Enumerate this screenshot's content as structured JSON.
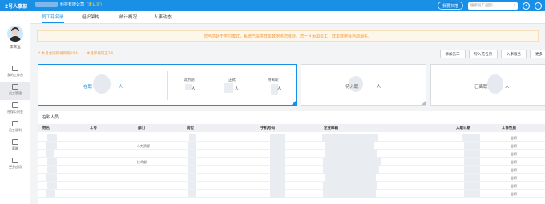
{
  "topbar": {
    "logo": "2号人事部",
    "company_suffix": "科技有限公司",
    "verified": "(未认证)",
    "help": "我要扫描",
    "search_placeholder": "搜索员工/团队",
    "search_icon_char": "⌕"
  },
  "sidebar": {
    "user_name": "李荣运",
    "items": [
      {
        "label": "我的工作台"
      },
      {
        "label": "员工管理"
      },
      {
        "label": "社保公积金"
      },
      {
        "label": "员工福利"
      },
      {
        "label": "薪酬"
      },
      {
        "label": "更多应用"
      }
    ]
  },
  "tabs": [
    "员工花名册",
    "组织架构",
    "统计概况",
    "人事动态"
  ],
  "notice": "您当前处于学习模式，系统已提供样本数据供您体验。您一旦添加员工，样本数据会自动消失。",
  "alerts": [
    "* 本月合同即将到期10人",
    "本月即将转正2人"
  ],
  "buttons": [
    "添加员工",
    "导入花名册",
    "入事服务",
    "更多"
  ],
  "cards": {
    "active": {
      "label": "在职",
      "unit": "人",
      "probation": "试用期",
      "regular": "正式",
      "pending_leave": "待离职",
      "probation_unit": "人",
      "regular_unit": "人",
      "pending_unit": "人"
    },
    "pending": {
      "label": "待入职",
      "unit": "人"
    },
    "left": {
      "label": "已离职",
      "unit": "人"
    }
  },
  "section_title": "在职人员",
  "table": {
    "headers": [
      "姓名",
      "工号",
      "部门",
      "岗位",
      "手机号码",
      "企业邮箱",
      "入职日期",
      "工作性质"
    ],
    "rows": [
      {
        "dept": "",
        "nature": "全职"
      },
      {
        "dept": "人力资源",
        "nature": "全职"
      },
      {
        "dept": "",
        "nature": "全职"
      },
      {
        "dept": "技术部",
        "nature": "全职"
      },
      {
        "dept": "",
        "nature": "全职"
      },
      {
        "dept": "",
        "nature": "全职"
      },
      {
        "dept": "",
        "nature": "全职"
      },
      {
        "dept": "",
        "nature": "全职"
      }
    ]
  },
  "colors": {
    "brand": "#1a8fe6",
    "warning": "#f29b38"
  }
}
